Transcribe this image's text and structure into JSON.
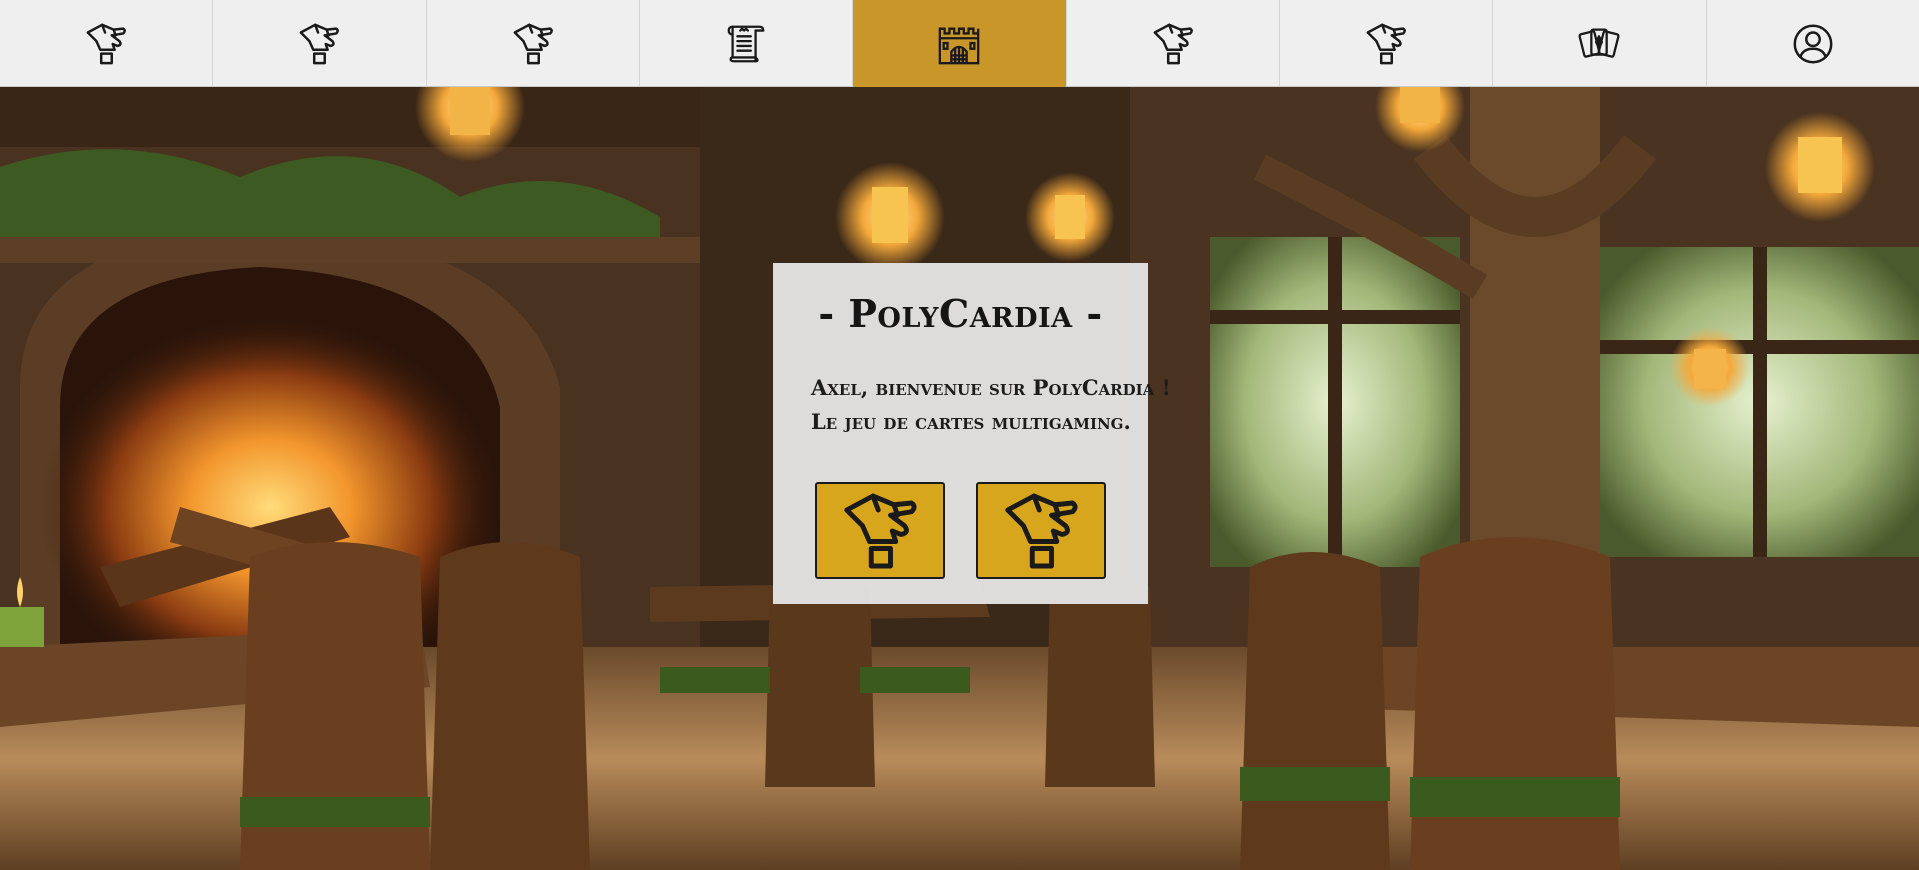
{
  "nav": {
    "items": [
      {
        "icon": "card-hand-icon",
        "active": false
      },
      {
        "icon": "card-hand-icon",
        "active": false
      },
      {
        "icon": "card-hand-icon",
        "active": false
      },
      {
        "icon": "scroll-icon",
        "active": false
      },
      {
        "icon": "castle-icon",
        "active": true
      },
      {
        "icon": "card-hand-icon",
        "active": false
      },
      {
        "icon": "card-hand-icon",
        "active": false
      },
      {
        "icon": "cards-deck-icon",
        "active": false
      },
      {
        "icon": "user-profile-icon",
        "active": false
      }
    ],
    "active_color": "#c9962a"
  },
  "card": {
    "title": "- PolyCardia -",
    "welcome_line": "Axel, bienvenue sur PolyCardia !",
    "tagline": "Le jeu de cartes multigaming.",
    "buttons": [
      {
        "icon": "card-hand-icon"
      },
      {
        "icon": "card-hand-icon"
      }
    ],
    "button_color": "#d8a61c"
  }
}
